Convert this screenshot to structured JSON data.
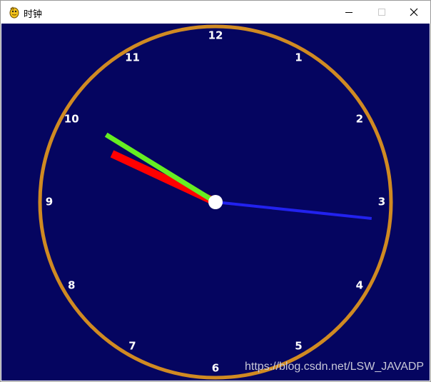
{
  "window": {
    "title": "时钟",
    "app_icon": "pygame-snake-icon",
    "controls": {
      "minimize": "minimize-icon",
      "maximize": "maximize-icon",
      "close": "close-icon"
    }
  },
  "clock": {
    "numbers": [
      "12",
      "1",
      "2",
      "3",
      "4",
      "5",
      "6",
      "7",
      "8",
      "9",
      "10",
      "11"
    ],
    "time": {
      "hour": 9,
      "minute": 50,
      "second": 16
    },
    "colors": {
      "background": "#050560",
      "rim": "#d08a22",
      "hour_hand": "#ff0000",
      "minute_hand": "#66ee22",
      "second_hand": "#2222ee",
      "center": "#ffffff",
      "numbers": "#ffffff"
    }
  },
  "watermark": "https://blog.csdn.net/LSW_JAVADP"
}
